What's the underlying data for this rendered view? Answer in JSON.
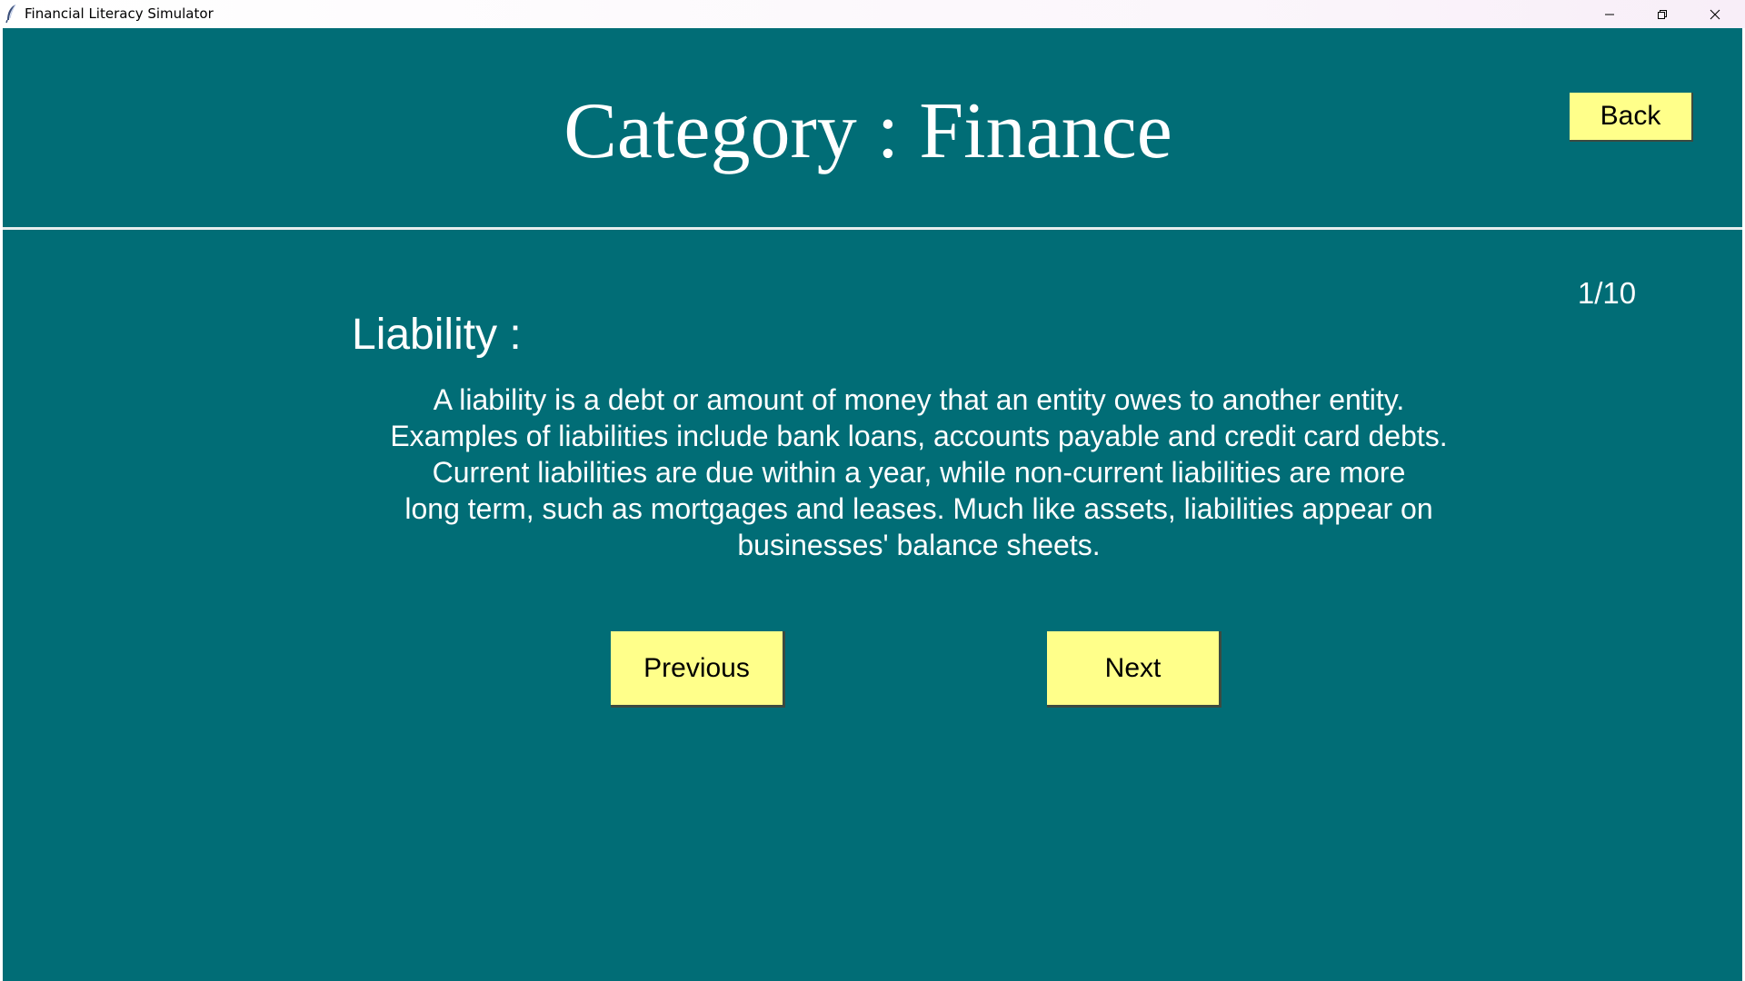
{
  "window": {
    "title": "Financial Literacy Simulator",
    "icon": "feather-icon",
    "controls": [
      "minimize-icon",
      "restore-icon",
      "close-icon"
    ]
  },
  "header": {
    "title": "Category : Finance",
    "back_label": "Back"
  },
  "content": {
    "counter": "1/10",
    "term": "Liability :",
    "description_lines": [
      "A liability is a debt or amount of money that an entity owes to another entity.",
      "Examples of liabilities include bank loans, accounts payable and credit card debts.",
      "Current liabilities are due within a year, while non-current liabilities are more",
      "long term, such as mortgages and leases. Much like assets, liabilities appear on",
      "businesses' balance sheets."
    ]
  },
  "navigation": {
    "previous_label": "Previous",
    "next_label": "Next"
  },
  "colors": {
    "background": "#016d76",
    "button": "#ffff8a",
    "text": "#ffffff"
  }
}
